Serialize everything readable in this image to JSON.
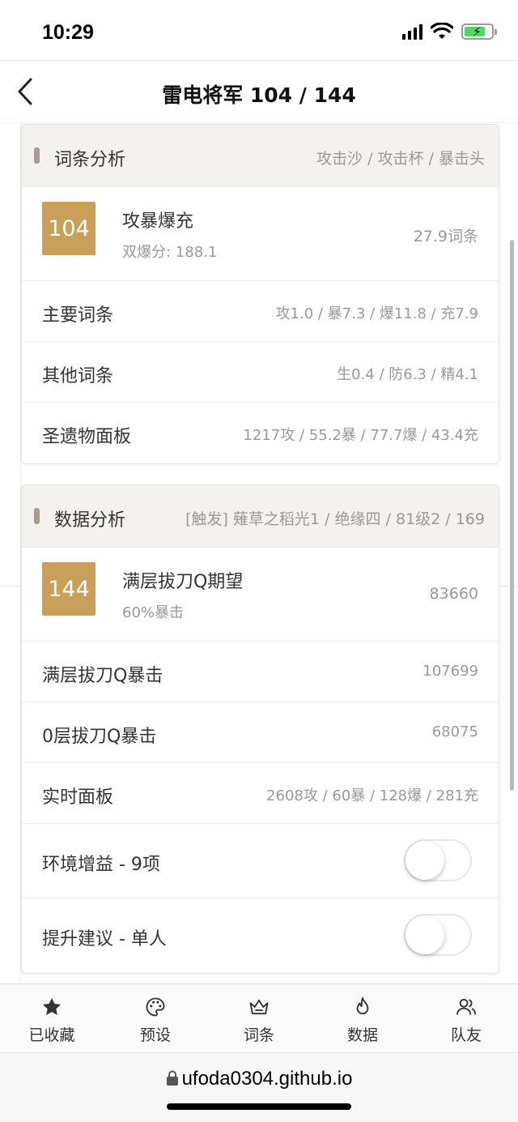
{
  "status_bar": {
    "time": "10:29"
  },
  "nav": {
    "title": "雷电将军 104 / 144"
  },
  "substats_card": {
    "title": "词条分析",
    "subtitle": "攻击沙 / 攻击杯 / 暴击头",
    "score": "104",
    "build_name": "攻暴爆充",
    "crit_value": "双爆分: 188.1",
    "total": "27.9词条",
    "rows": [
      {
        "label": "主要词条",
        "value": "攻1.0 / 暴7.3 / 爆11.8 / 充7.9"
      },
      {
        "label": "其他词条",
        "value": "生0.4 / 防6.3 / 精4.1"
      },
      {
        "label": "圣遗物面板",
        "value": "1217攻 / 55.2暴 / 77.7爆 / 43.4充"
      }
    ]
  },
  "damage_card": {
    "title": "数据分析",
    "subtitle": "[触发] 薙草之稻光1 / 绝缘四 / 81级2 / 169",
    "score": "144",
    "metric_name": "满层拔刀Q期望",
    "crit_rate": "60%暴击",
    "metric_value": "83660",
    "rows": [
      {
        "label": "满层拔刀Q暴击",
        "value": "107699"
      },
      {
        "label": "0层拔刀Q暴击",
        "value": "68075"
      },
      {
        "label": "实时面板",
        "value": "2608攻 / 60暴 / 128爆 / 281充"
      }
    ],
    "toggles": [
      {
        "label": "环境增益 - 9项",
        "on": false
      },
      {
        "label": "提升建议 - 单人",
        "on": false
      }
    ]
  },
  "tabbar": {
    "items": [
      {
        "label": "已收藏",
        "icon": "star-icon"
      },
      {
        "label": "预设",
        "icon": "palette-icon"
      },
      {
        "label": "词条",
        "icon": "crown-icon"
      },
      {
        "label": "数据",
        "icon": "flame-icon"
      },
      {
        "label": "队友",
        "icon": "users-icon"
      }
    ]
  },
  "browser": {
    "url": "ufoda0304.github.io"
  },
  "colors": {
    "accent": "#c8a05a",
    "header_bg": "#f4f2ee",
    "bar": "#a79b8f"
  }
}
